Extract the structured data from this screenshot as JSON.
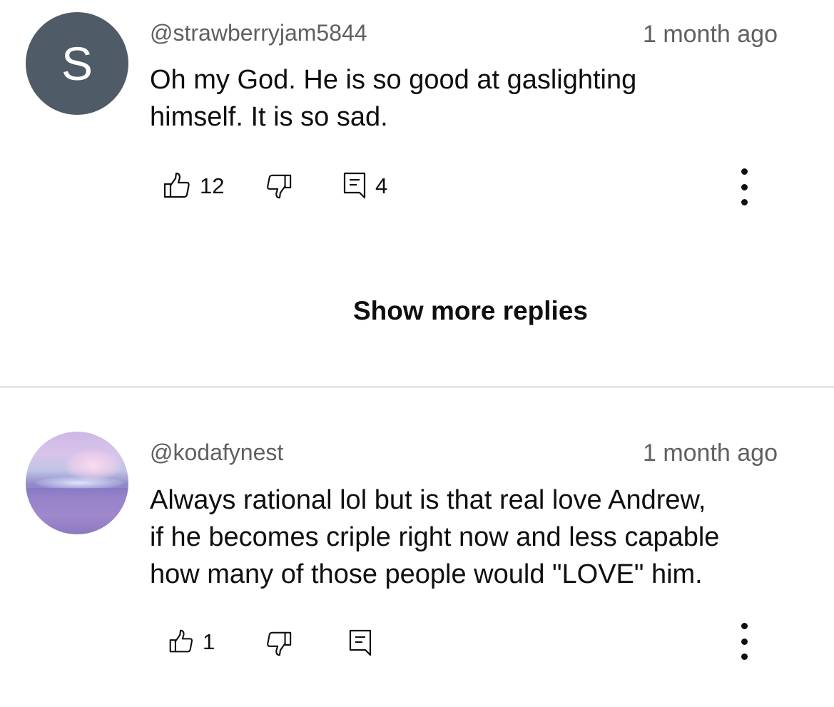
{
  "comments": [
    {
      "avatar_initial": "S",
      "avatar_color": "#4f5b66",
      "handle": "@strawberryjam5844",
      "time": "1 month ago",
      "text": "Oh my God. He is so good at gaslighting\nhimself. It is so sad.",
      "like_count": "12",
      "reply_count": "4"
    },
    {
      "avatar_initial": "",
      "handle": "@kodafynest",
      "time": "1 month ago",
      "text": "Always rational lol but is that real love Andrew,\nif he becomes criple right now and less capable\nhow many of those people would \"LOVE\" him.",
      "like_count": "1",
      "reply_count": ""
    }
  ],
  "show_more_replies": "Show more replies",
  "icons": {
    "like": "thumbs-up-icon",
    "dislike": "thumbs-down-icon",
    "reply": "comment-icon",
    "more": "more-vert-icon"
  },
  "colors": {
    "text": "#0f0f0f",
    "secondary": "#606060",
    "divider": "#e8e8e8"
  }
}
